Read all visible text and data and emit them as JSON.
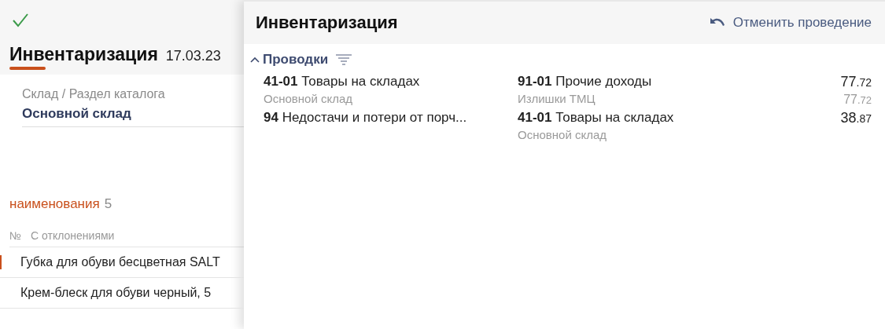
{
  "left": {
    "title": "Инвентаризация",
    "date": "17.03.23",
    "field": {
      "label": "Склад / Раздел каталога",
      "value": "Основной склад"
    },
    "section": {
      "title": "наименования",
      "count": "5"
    },
    "columns": [
      "№",
      "С отклонениями"
    ],
    "rows": [
      {
        "name": "Губка для обуви бесцветная SALT",
        "selected": true
      },
      {
        "name": "Крем-блеск для обуви черный, 5",
        "selected": false
      }
    ]
  },
  "panel": {
    "title": "Инвентаризация",
    "action": "Отменить проведение",
    "group": {
      "title": "Проводки",
      "expanded": true
    },
    "entries": [
      {
        "debit": {
          "code": "41-01",
          "name": "Товары на складах",
          "sub": "Основной склад"
        },
        "credit": {
          "code": "91-01",
          "name": "Прочие доходы",
          "sub": "Излишки ТМЦ"
        },
        "amount": {
          "int": "77",
          "frac": ".72"
        },
        "amount_sub": {
          "int": "77",
          "frac": ".72"
        }
      },
      {
        "debit": {
          "code": "94",
          "name": "Недостачи и потери от порч..."
        },
        "credit": {
          "code": "41-01",
          "name": "Товары на складах",
          "sub": "Основной склад"
        },
        "amount": {
          "int": "38",
          "frac": ".87"
        }
      }
    ]
  }
}
